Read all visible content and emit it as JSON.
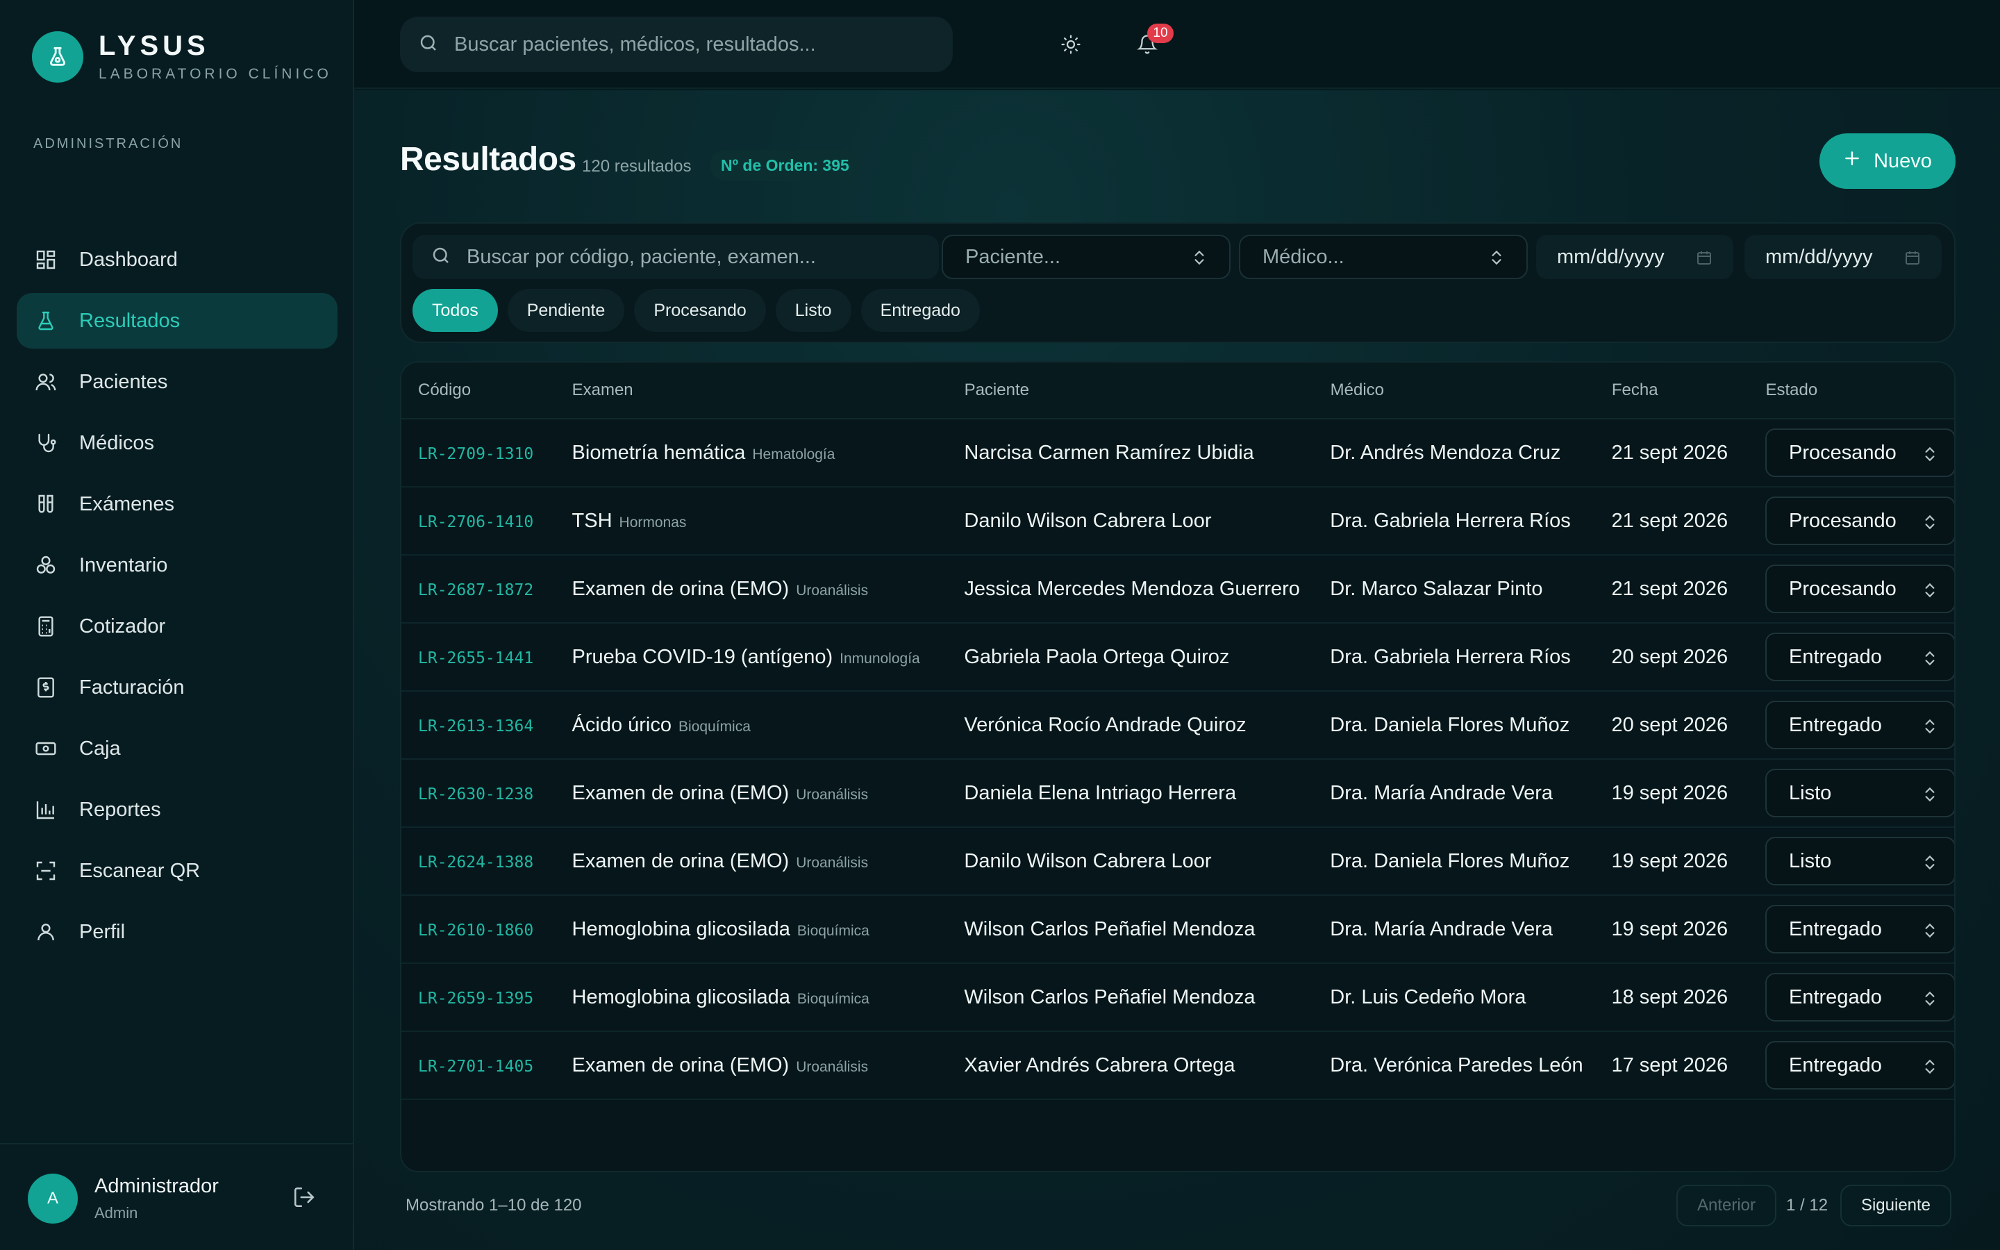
{
  "brand": {
    "name": "LYSUS",
    "subtitle": "LABORATORIO CLÍNICO"
  },
  "sidebar": {
    "section": "ADMINISTRACIÓN",
    "items": [
      {
        "label": "Dashboard",
        "icon": "dashboard-icon",
        "active": false
      },
      {
        "label": "Resultados",
        "icon": "flask-icon",
        "active": true
      },
      {
        "label": "Pacientes",
        "icon": "users-icon",
        "active": false
      },
      {
        "label": "Médicos",
        "icon": "stethoscope-icon",
        "active": false
      },
      {
        "label": "Exámenes",
        "icon": "test-tubes-icon",
        "active": false
      },
      {
        "label": "Inventario",
        "icon": "boxes-icon",
        "active": false
      },
      {
        "label": "Cotizador",
        "icon": "calculator-icon",
        "active": false
      },
      {
        "label": "Facturación",
        "icon": "invoice-icon",
        "active": false
      },
      {
        "label": "Caja",
        "icon": "cash-icon",
        "active": false
      },
      {
        "label": "Reportes",
        "icon": "bar-chart-icon",
        "active": false
      },
      {
        "label": "Escanear QR",
        "icon": "scan-icon",
        "active": false
      },
      {
        "label": "Perfil",
        "icon": "user-icon",
        "active": false
      }
    ],
    "user": {
      "initial": "A",
      "name": "Administrador",
      "role": "Admin"
    }
  },
  "topbar": {
    "search_placeholder": "Buscar pacientes, médicos, resultados...",
    "notifications": "10"
  },
  "page": {
    "title": "Resultados",
    "count": "120 resultados",
    "order": "Nº de Orden: 395",
    "new_label": "Nuevo"
  },
  "filters": {
    "search_placeholder": "Buscar por código, paciente, examen...",
    "patient_placeholder": "Paciente...",
    "doctor_placeholder": "Médico...",
    "date_from": "mm/dd/yyyy",
    "date_to": "mm/dd/yyyy",
    "chips": [
      "Todos",
      "Pendiente",
      "Procesando",
      "Listo",
      "Entregado"
    ],
    "active_chip": "Todos"
  },
  "table": {
    "headers": {
      "code": "Código",
      "exam": "Examen",
      "patient": "Paciente",
      "doctor": "Médico",
      "date": "Fecha",
      "state": "Estado"
    },
    "rows": [
      {
        "code": "LR-2709-1310",
        "exam": "Biometría hemática",
        "category": "Hematología",
        "patient": "Narcisa Carmen Ramírez Ubidia",
        "doctor": "Dr. Andrés Mendoza Cruz",
        "date": "21 sept 2026",
        "state": "Procesando"
      },
      {
        "code": "LR-2706-1410",
        "exam": "TSH",
        "category": "Hormonas",
        "patient": "Danilo Wilson Cabrera Loor",
        "doctor": "Dra. Gabriela Herrera Ríos",
        "date": "21 sept 2026",
        "state": "Procesando"
      },
      {
        "code": "LR-2687-1872",
        "exam": "Examen de orina (EMO)",
        "category": "Uroanálisis",
        "patient": "Jessica Mercedes Mendoza Guerrero",
        "doctor": "Dr. Marco Salazar Pinto",
        "date": "21 sept 2026",
        "state": "Procesando"
      },
      {
        "code": "LR-2655-1441",
        "exam": "Prueba COVID-19 (antígeno)",
        "category": "Inmunología",
        "patient": "Gabriela Paola Ortega Quiroz",
        "doctor": "Dra. Gabriela Herrera Ríos",
        "date": "20 sept 2026",
        "state": "Entregado"
      },
      {
        "code": "LR-2613-1364",
        "exam": "Ácido úrico",
        "category": "Bioquímica",
        "patient": "Verónica Rocío Andrade Quiroz",
        "doctor": "Dra. Daniela Flores Muñoz",
        "date": "20 sept 2026",
        "state": "Entregado"
      },
      {
        "code": "LR-2630-1238",
        "exam": "Examen de orina (EMO)",
        "category": "Uroanálisis",
        "patient": "Daniela Elena Intriago Herrera",
        "doctor": "Dra. María Andrade Vera",
        "date": "19 sept 2026",
        "state": "Listo"
      },
      {
        "code": "LR-2624-1388",
        "exam": "Examen de orina (EMO)",
        "category": "Uroanálisis",
        "patient": "Danilo Wilson Cabrera Loor",
        "doctor": "Dra. Daniela Flores Muñoz",
        "date": "19 sept 2026",
        "state": "Listo"
      },
      {
        "code": "LR-2610-1860",
        "exam": "Hemoglobina glicosilada",
        "category": "Bioquímica",
        "patient": "Wilson Carlos Peñafiel Mendoza",
        "doctor": "Dra. María Andrade Vera",
        "date": "19 sept 2026",
        "state": "Entregado"
      },
      {
        "code": "LR-2659-1395",
        "exam": "Hemoglobina glicosilada",
        "category": "Bioquímica",
        "patient": "Wilson Carlos Peñafiel Mendoza",
        "doctor": "Dr. Luis Cedeño Mora",
        "date": "18 sept 2026",
        "state": "Entregado"
      },
      {
        "code": "LR-2701-1405",
        "exam": "Examen de orina (EMO)",
        "category": "Uroanálisis",
        "patient": "Xavier Andrés Cabrera Ortega",
        "doctor": "Dra. Verónica Paredes León",
        "date": "17 sept 2026",
        "state": "Entregado"
      }
    ]
  },
  "pagination": {
    "info": "Mostrando 1–10 de 120",
    "prev": "Anterior",
    "page": "1 / 12",
    "next": "Siguiente"
  },
  "colors": {
    "accent": "#12a394",
    "accent_text": "#22b8a4",
    "background": "#061a1e",
    "badge": "#e23b4a"
  }
}
